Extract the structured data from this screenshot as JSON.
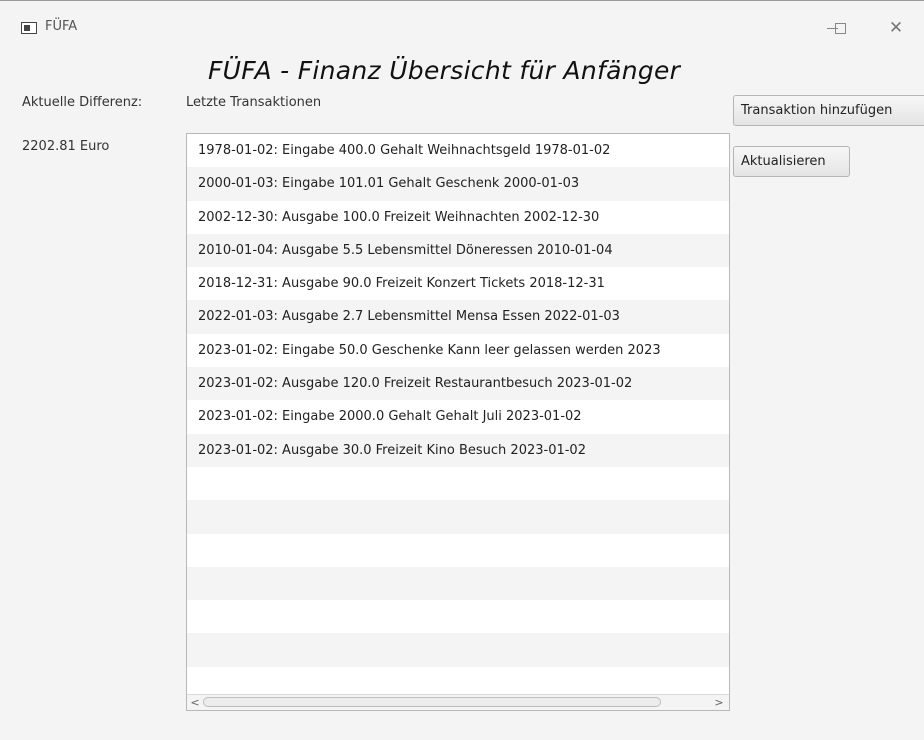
{
  "window": {
    "title": "FÜFA",
    "min_glyph": "—",
    "close_glyph": "✕"
  },
  "header": {
    "app_title": "FÜFA - Finanz Übersicht für Anfänger"
  },
  "left": {
    "difference_label": "Aktuelle Differenz:",
    "difference_value": "2202.81 Euro"
  },
  "transactions": {
    "label": "Letzte Transaktionen",
    "items": [
      "1978-01-02: Eingabe 400.0 Gehalt Weihnachtsgeld 1978-01-02",
      "2000-01-03: Eingabe 101.01 Gehalt Geschenk 2000-01-03",
      "2002-12-30: Ausgabe 100.0 Freizeit Weihnachten 2002-12-30",
      "2010-01-04: Ausgabe 5.5 Lebensmittel Döneressen 2010-01-04",
      "2018-12-31: Ausgabe 90.0 Freizeit Konzert Tickets 2018-12-31",
      "2022-01-03: Ausgabe 2.7 Lebensmittel Mensa Essen 2022-01-03",
      "2023-01-02: Eingabe 50.0 Geschenke Kann leer gelassen werden 2023",
      "2023-01-02: Ausgabe 120.0 Freizeit Restaurantbesuch 2023-01-02",
      "2023-01-02: Eingabe 2000.0 Gehalt Gehalt Juli 2023-01-02",
      "2023-01-02: Ausgabe 30.0 Freizeit Kino Besuch 2023-01-02",
      "",
      "",
      "",
      "",
      "",
      "",
      ""
    ],
    "scroll_left": "<",
    "scroll_right": ">"
  },
  "buttons": {
    "add": "Transaktion hinzufügen",
    "refresh": "Aktualisieren"
  }
}
